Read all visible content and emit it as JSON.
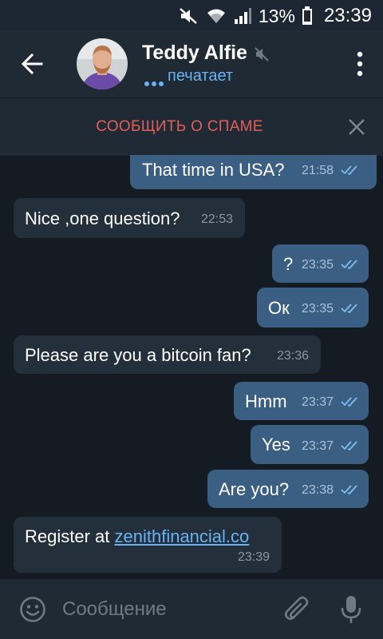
{
  "status_bar": {
    "battery_percent": "13%",
    "time": "23:39",
    "icons": [
      "mute-icon",
      "wifi-icon",
      "signal-icon",
      "battery-icon"
    ]
  },
  "header": {
    "contact_name": "Teddy Alfie",
    "status": "печатает",
    "accent_color": "#6ab3f3"
  },
  "spam_bar": {
    "report_label": "СООБЩИТЬ О СПАМЕ",
    "report_color": "#e05f5a"
  },
  "messages": [
    {
      "direction": "out",
      "text": "That time in USA?",
      "time": "21:58",
      "read": true
    },
    {
      "direction": "in",
      "text": "Nice ,one question?",
      "time": "22:53"
    },
    {
      "direction": "out",
      "text": "?",
      "time": "23:35",
      "read": true
    },
    {
      "direction": "out",
      "text": "Ок",
      "time": "23:35",
      "read": true
    },
    {
      "direction": "in",
      "text": "Please are you a bitcoin fan?",
      "time": "23:36"
    },
    {
      "direction": "out",
      "text": "Hmm",
      "time": "23:37",
      "read": true
    },
    {
      "direction": "out",
      "text": "Yes",
      "time": "23:37",
      "read": true
    },
    {
      "direction": "out",
      "text": "Are you?",
      "time": "23:38",
      "read": true
    },
    {
      "direction": "in",
      "text_prefix": "Register at ",
      "link": "zenithfinancial.co",
      "time": "23:39"
    }
  ],
  "input_bar": {
    "placeholder": "Сообщение"
  },
  "colors": {
    "outgoing_bubble": "#3b5f82",
    "incoming_bubble": "#232f3b",
    "background": "#141b22",
    "header": "#1f2a35"
  }
}
